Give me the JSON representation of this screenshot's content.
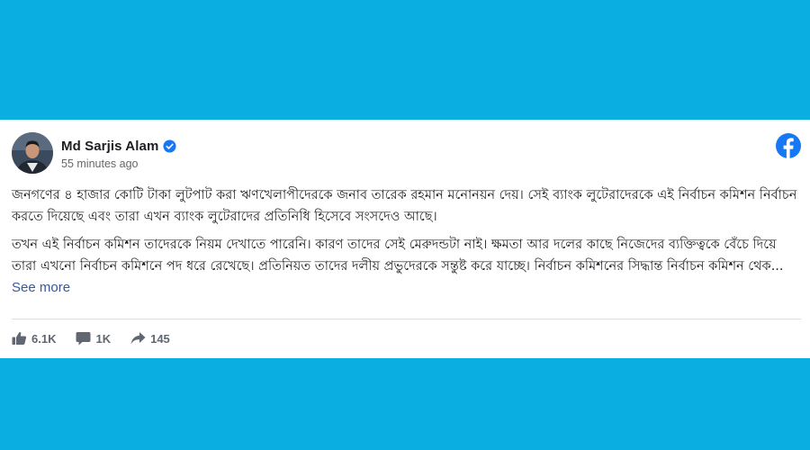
{
  "post": {
    "author": "Md Sarjis Alam",
    "timestamp": "55 minutes ago",
    "paragraphs": [
      "জনগণের ৪ হাজার কোটি টাকা লুটপাট করা ঋণখেলাপীদেরকে জনাব তারেক রহমান মনোনয়ন দেয়। সেই ব্যাংক লুটেরাদেরকে এই নির্বাচন কমিশন নির্বাচন করতে দিয়েছে এবং তারা এখন ব্যাংক লুটেরাদের প্রতিনিধি হিসেবে সংসদেও আছে।",
      "তখন এই নির্বাচন কমিশন তাদেরকে নিয়ম দেখাতে পারেনি। কারণ তাদের সেই মেরুদন্ডটা নাই। ক্ষমতা আর দলের কাছে নিজেদের ব্যক্তিত্বকে বেঁচে দিয়ে তারা এখনো নির্বাচন কমিশনে পদ ধরে রেখেছে। প্রতিনিয়ত তাদের দলীয় প্রভুদেরকে সন্তুষ্ট করে যাচ্ছে। নির্বাচন কমিশনের সিদ্ধান্ত নির্বাচন কমিশন থেক..."
    ],
    "see_more": "See more"
  },
  "stats": {
    "likes": "6.1K",
    "comments": "1K",
    "shares": "145"
  },
  "icons": {
    "verified": "verified-badge-icon",
    "brand": "facebook-logo-icon",
    "like": "thumbs-up-icon",
    "comment": "comment-icon",
    "share": "share-arrow-icon"
  },
  "colors": {
    "background": "#0aaee1",
    "facebook_blue": "#1877f2",
    "link": "#385898",
    "muted": "#606770"
  }
}
